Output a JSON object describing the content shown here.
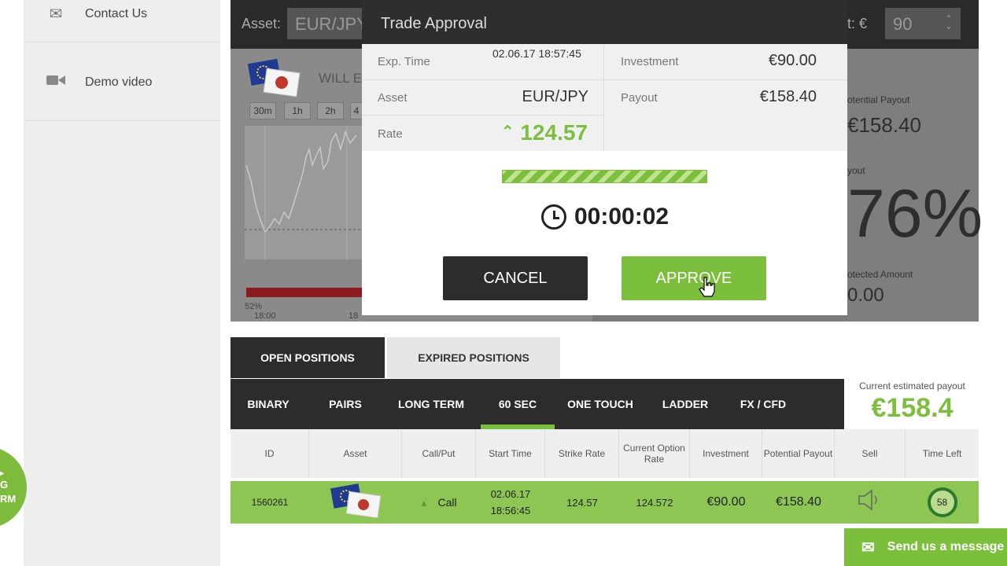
{
  "sidebar": {
    "items": [
      {
        "label": "Contact Us",
        "icon": "envelope-icon"
      },
      {
        "label": "Demo video",
        "icon": "video-camera-icon"
      }
    ],
    "fab_text": [
      "G",
      "RM"
    ]
  },
  "panel": {
    "asset_label": "Asset:",
    "asset_value": "EUR/JPY",
    "investment_label": "t: €",
    "investment_value": "90",
    "will_label": "WILL E",
    "timeframes": [
      "30m",
      "1h",
      "2h",
      "4"
    ],
    "x_ticks": [
      "18:00",
      "18"
    ],
    "left_percent": "52%",
    "right": {
      "potential_payout_label": "otential Payout",
      "potential_payout_value": "€158.40",
      "payout_label": "yout",
      "payout_value": "76%",
      "protected_label": "otected Amount",
      "protected_value": "0.00"
    }
  },
  "modal": {
    "title": "Trade Approval",
    "exp_time_label": "Exp. Time",
    "exp_time_value": "02.06.17 18:57:45",
    "asset_label": "Asset",
    "asset_value": "EUR/JPY",
    "rate_label": "Rate",
    "rate_value": "124.57",
    "investment_label": "Investment",
    "investment_value": "€90.00",
    "payout_label": "Payout",
    "payout_value": "€158.40",
    "progress": 1.0,
    "timer": "00:00:02",
    "cancel_label": "CANCEL",
    "approve_label": "APPROVE"
  },
  "positions": {
    "tabs": [
      "OPEN POSITIONS",
      "EXPIRED POSITIONS"
    ],
    "categories": [
      "BINARY",
      "PAIRS",
      "LONG TERM",
      "60 SEC",
      "ONE TOUCH",
      "LADDER",
      "FX / CFD"
    ],
    "active_category": "60 SEC",
    "estimated_payout_label": "Current estimated payout",
    "estimated_payout_value": "€158.4",
    "columns": [
      "ID",
      "Asset",
      "Call/Put",
      "Start Time",
      "Strike Rate",
      "Current Option Rate",
      "Investment",
      "Potential Payout",
      "Sell",
      "Time Left"
    ],
    "rows": [
      {
        "id": "1560261",
        "asset_icon": "eur-jpy-flags-icon",
        "call_put": "Call",
        "start_date": "02.06.17",
        "start_time": "18:56:45",
        "strike_rate": "124.57",
        "current_rate": "124.572",
        "investment": "€90.00",
        "potential_payout": "€158.40",
        "sell_icon": "speaker-icon",
        "time_left": "58"
      }
    ]
  },
  "chat": {
    "label": "Send us a message",
    "icon": "envelope-icon"
  },
  "colors": {
    "accent": "#7cbf3d",
    "dark": "#2c2c2c",
    "row_green": "#8dc653"
  }
}
